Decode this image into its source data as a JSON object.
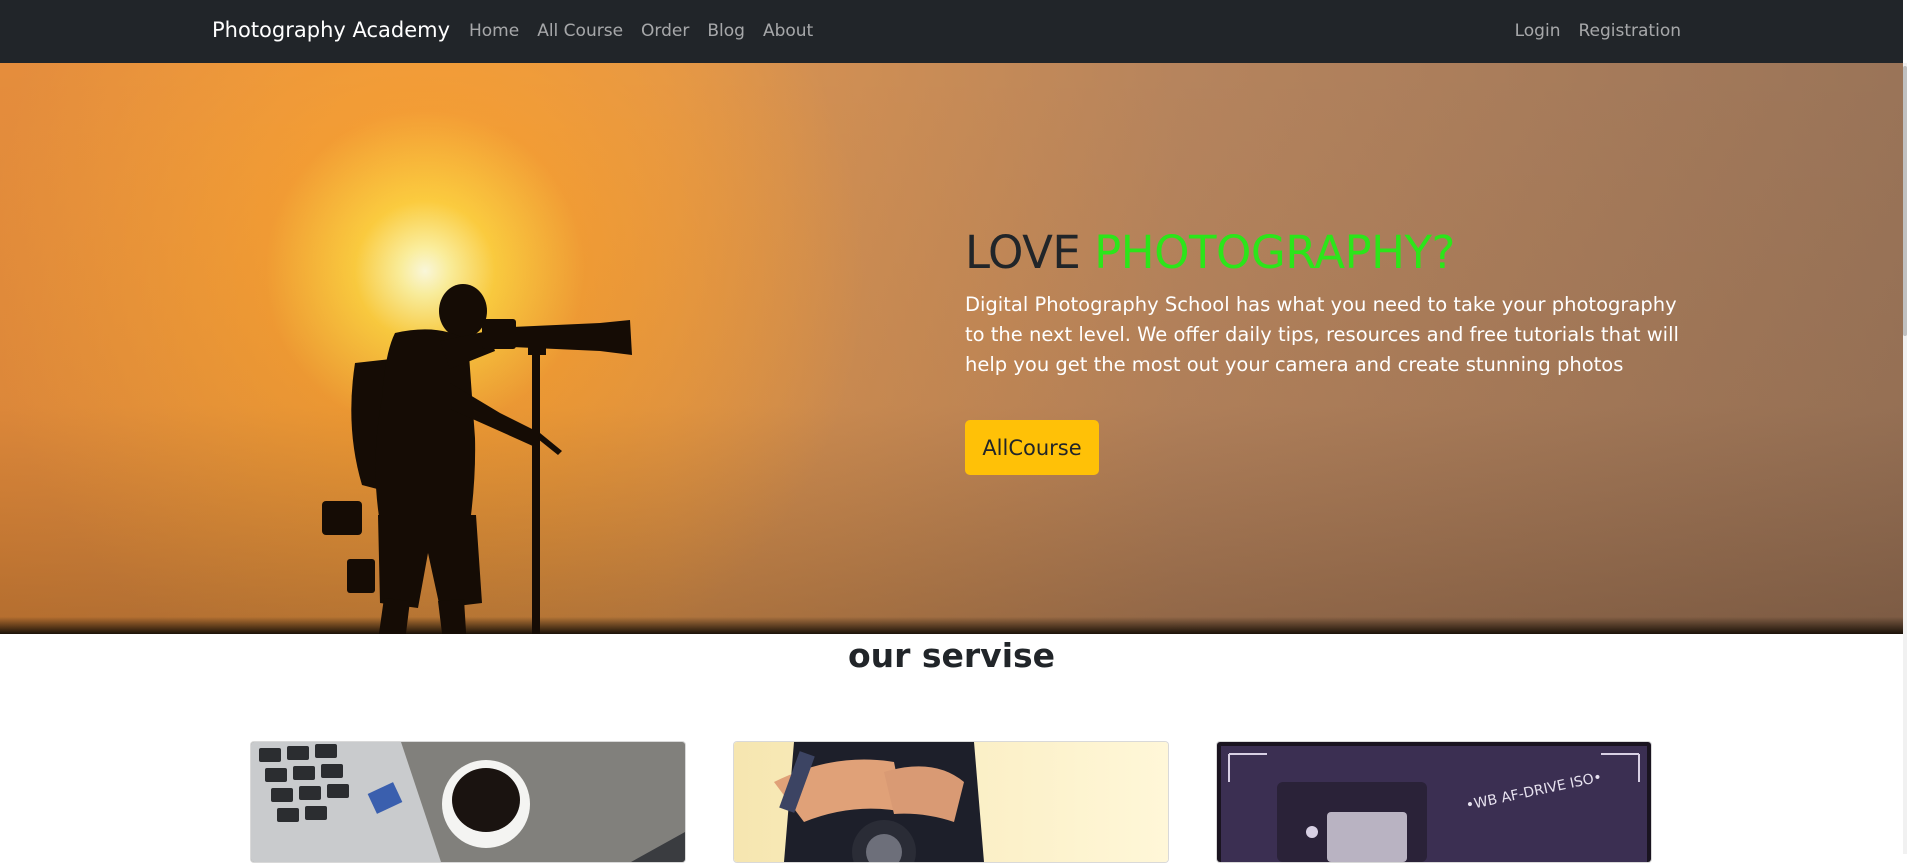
{
  "navbar": {
    "brand": "Photography Academy",
    "links": [
      "Home",
      "All Course",
      "Order",
      "Blog",
      "About"
    ],
    "right_links": [
      "Login",
      "Registration"
    ]
  },
  "hero": {
    "title_dark": "LOVE",
    "title_accent": "PHOTOGRAPHY?",
    "description": "Digital Photography School has what you need to take your photography to the next level. We offer daily tips, resources and free tutorials that will help you get the most out your camera and create stunning photos",
    "cta_label": "AllCourse",
    "accent_color": "#2ce51a",
    "cta_color": "#ffc107",
    "image_description": "photographer-silhouette-sunset"
  },
  "services": {
    "title": "our servise",
    "cards": [
      {
        "image": "laptop-and-coffee-image"
      },
      {
        "image": "camera-lens-hands-image"
      },
      {
        "image": "camera-top-dial-image"
      }
    ]
  },
  "colors": {
    "navbar_bg": "#212529",
    "nav_link": "rgba(255,255,255,0.6)"
  }
}
